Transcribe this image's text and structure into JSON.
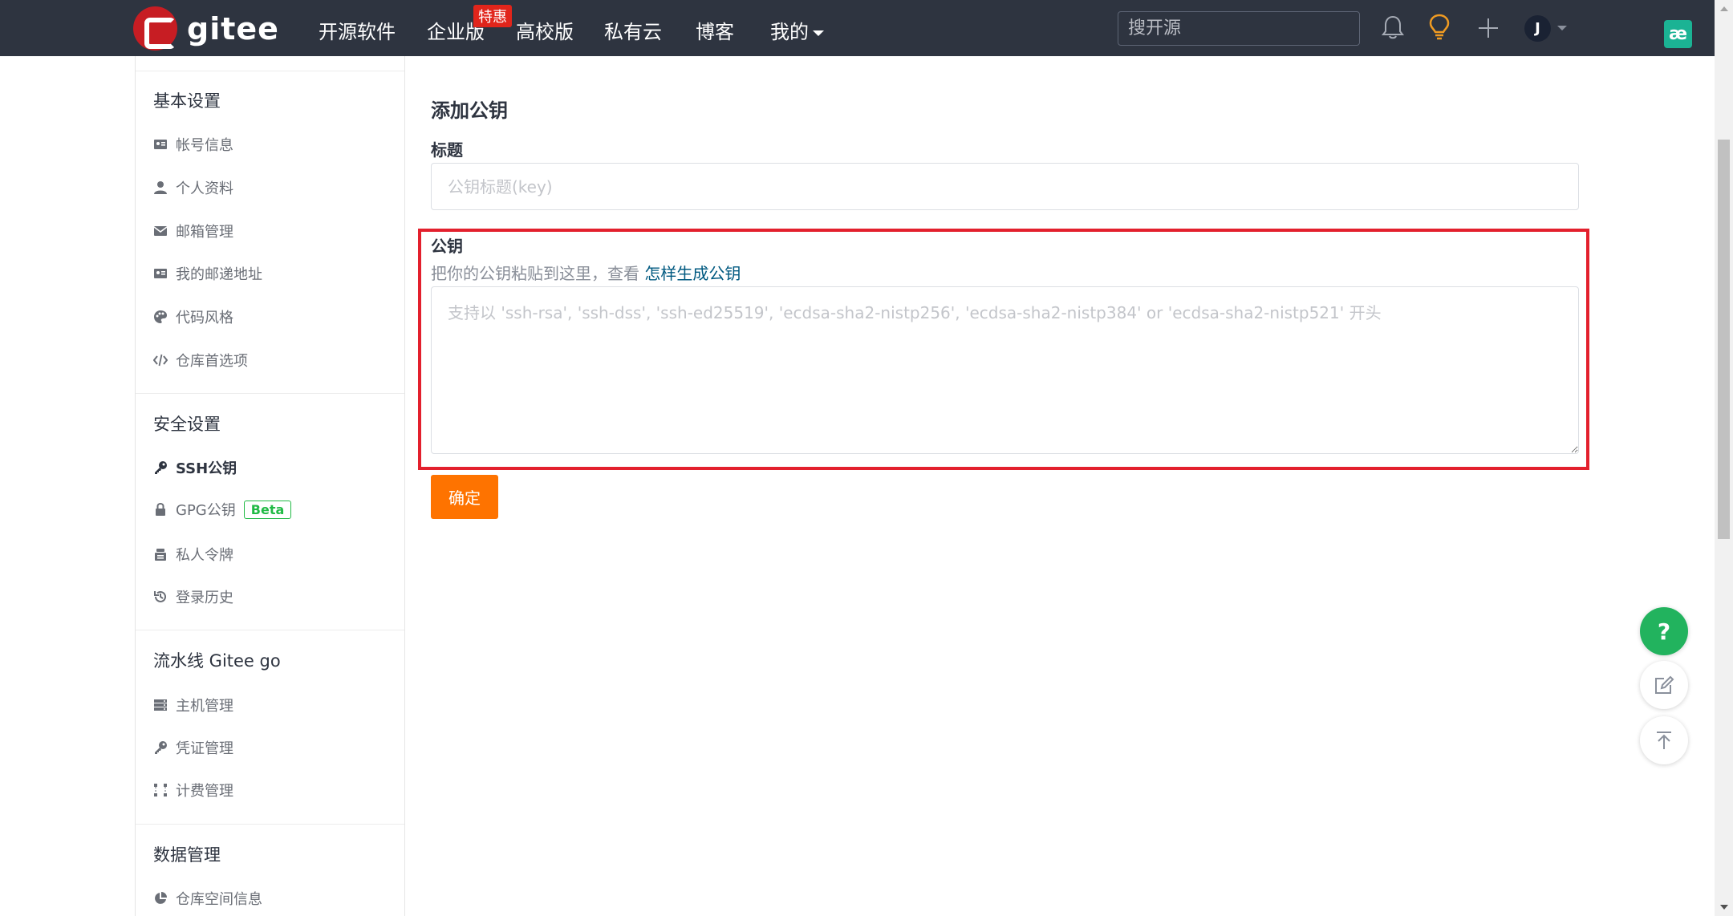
{
  "nav": {
    "logo_text": "gitee",
    "links": [
      "开源软件",
      "企业版",
      "高校版",
      "私有云",
      "博客",
      "我的"
    ],
    "promo_badge": "特惠",
    "search_placeholder": "搜开源",
    "avatar_initial": "J",
    "extension_icon_text": "æ"
  },
  "sidebar": {
    "sections": [
      {
        "title": "基本设置",
        "items": [
          {
            "label": "帐号信息",
            "icon": "id-card-icon"
          },
          {
            "label": "个人资料",
            "icon": "user-icon"
          },
          {
            "label": "邮箱管理",
            "icon": "mail-icon"
          },
          {
            "label": "我的邮递地址",
            "icon": "address-card-icon"
          },
          {
            "label": "代码风格",
            "icon": "palette-icon"
          },
          {
            "label": "仓库首选项",
            "icon": "code-icon"
          }
        ]
      },
      {
        "title": "安全设置",
        "items": [
          {
            "label": "SSH公钥",
            "icon": "key-icon",
            "active": true
          },
          {
            "label": "GPG公钥",
            "icon": "lock-icon",
            "badge": "Beta"
          },
          {
            "label": "私人令牌",
            "icon": "token-icon"
          },
          {
            "label": "登录历史",
            "icon": "history-icon"
          }
        ]
      },
      {
        "title": "流水线 Gitee go",
        "items": [
          {
            "label": "主机管理",
            "icon": "server-icon"
          },
          {
            "label": "凭证管理",
            "icon": "key-icon"
          },
          {
            "label": "计费管理",
            "icon": "billing-icon"
          }
        ]
      },
      {
        "title": "数据管理",
        "items": [
          {
            "label": "仓库空间信息",
            "icon": "pie-chart-icon"
          }
        ]
      }
    ]
  },
  "main": {
    "title": "添加公钥",
    "title_field": {
      "label": "标题",
      "placeholder": "公钥标题(key)",
      "value": ""
    },
    "key_field": {
      "label": "公钥",
      "hint_prefix": "把你的公钥粘贴到这里，查看 ",
      "hint_link": "怎样生成公钥",
      "placeholder": "支持以 'ssh-rsa', 'ssh-dss', 'ssh-ed25519', 'ecdsa-sha2-nistp256', 'ecdsa-sha2-nistp384' or 'ecdsa-sha2-nistp521' 开头",
      "value": ""
    },
    "submit_label": "确定"
  },
  "floating": {
    "help_label": "?"
  },
  "colors": {
    "nav_bg": "#2e3440",
    "brand_red": "#c71d23",
    "submit_orange": "#fe7300",
    "highlight_red": "#e3202d",
    "link_blue": "#005980",
    "beta_green": "#21ba45",
    "help_green": "#22b35e"
  }
}
